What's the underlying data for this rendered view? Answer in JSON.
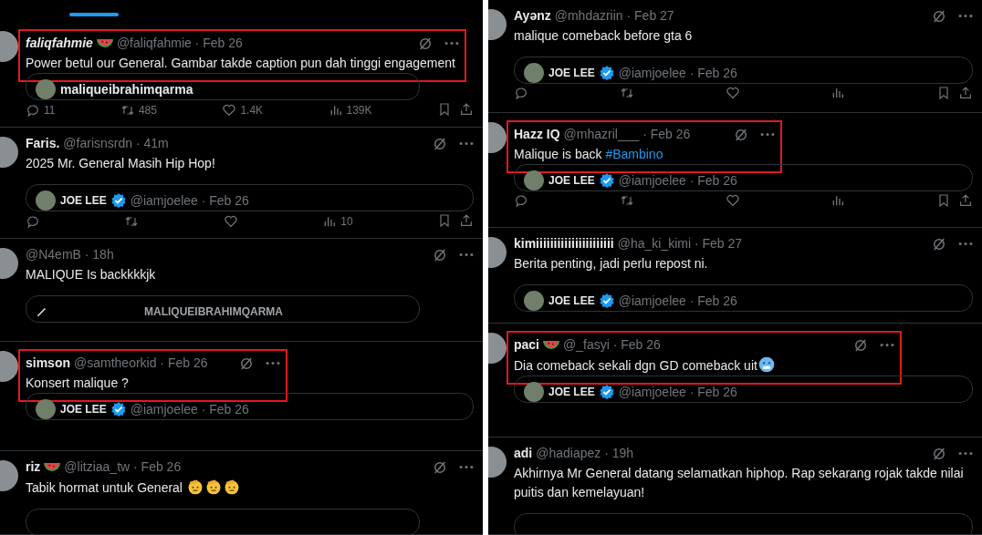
{
  "columns": [
    {
      "tweets": [
        {
          "name": "faliqfahmie",
          "name_italic": true,
          "badge": {
            "kind": "watermelon"
          },
          "handle_time": "@faliqfahmie · Feb 26",
          "text": "Power betul our General. Gambar takde caption pun dah tinggi engagement",
          "highlighted": true,
          "quote": {
            "kind": "profile",
            "title": "maliqueibrahimqarma"
          },
          "show_actions": true,
          "actions": {
            "reply": "11",
            "repost": "485",
            "like": "1.4K",
            "views": "139K"
          }
        },
        {
          "name": "Faris.",
          "handle_time": "@farisnsrdn · 41m",
          "text": "2025 Mr. General Masih Hip Hop!",
          "highlighted": false,
          "quote": {
            "kind": "author",
            "name": "JOE LEE",
            "verified": true,
            "handle_time": "@iamjoelee · Feb 26"
          },
          "show_actions": true,
          "actions": {
            "views": "10"
          }
        },
        {
          "handle_time": "@N4emB · 18h",
          "text": "MALIQUE Is backkkkjk",
          "highlighted": false,
          "quote": {
            "kind": "banner",
            "title": "MALIQUEIBRAHIMQARMA"
          }
        },
        {
          "name": "simson",
          "handle_time": "@samtheorkid · Feb 26",
          "text": "Konsert malique ?",
          "highlighted": true,
          "quote": {
            "kind": "author",
            "name": "JOE LEE",
            "verified": true,
            "handle_time": "@iamjoelee · Feb 26"
          }
        },
        {
          "name": "riz",
          "badge": {
            "kind": "watermelon"
          },
          "handle_time": "@litziaa_tw · Feb 26",
          "text": "Tabik hormat untuk General",
          "text_emoji": [
            {
              "kind": "salute"
            },
            {
              "kind": "salute"
            },
            {
              "kind": "salute"
            }
          ],
          "highlighted": false,
          "quote": {
            "kind": "empty"
          }
        }
      ]
    },
    {
      "tweets": [
        {
          "name": "Ayənz",
          "handle_time": "@mhdazriin · Feb 27",
          "text": "malique comeback before gta 6",
          "highlighted": false,
          "quote": {
            "kind": "author",
            "name": "JOE LEE",
            "verified": true,
            "handle_time": "@iamjoelee · Feb 26"
          },
          "show_actions": true
        },
        {
          "name": "Hazz IQ",
          "handle_time": "@mhazril___ · Feb 26",
          "text": "Malique is back",
          "hashtag": "#Bambino",
          "highlighted": true,
          "quote": {
            "kind": "author",
            "name": "JOE LEE",
            "verified": true,
            "handle_time": "@iamjoelee · Feb 26"
          },
          "show_actions": true
        },
        {
          "name": "kimiiiiiiiiiiiiiiiiiiiiii",
          "handle_time": "@ha_ki_kimi · Feb 27",
          "text": "Berita penting, jadi perlu repost ni.",
          "highlighted": false,
          "quote": {
            "kind": "author",
            "name": "JOE LEE",
            "verified": true,
            "handle_time": "@iamjoelee · Feb 26"
          }
        },
        {
          "name": "paci",
          "badge": {
            "kind": "watermelon"
          },
          "handle_time": "@_fasyi · Feb 26",
          "text": "Dia comeback sekali dgn GD comeback uit",
          "text_emoji": [
            {
              "kind": "cold"
            }
          ],
          "highlighted": true,
          "quote": {
            "kind": "author",
            "name": "JOE LEE",
            "verified": true,
            "handle_time": "@iamjoelee · Feb 26"
          }
        },
        {
          "name": "adi",
          "handle_time": "@hadiapez · 19h",
          "text": "Akhirnya Mr General datang selamatkan hiphop. Rap sekarang rojak takde nilai puitis dan kemelayuan!",
          "highlighted": false,
          "quote": {
            "kind": "empty"
          }
        }
      ]
    }
  ]
}
